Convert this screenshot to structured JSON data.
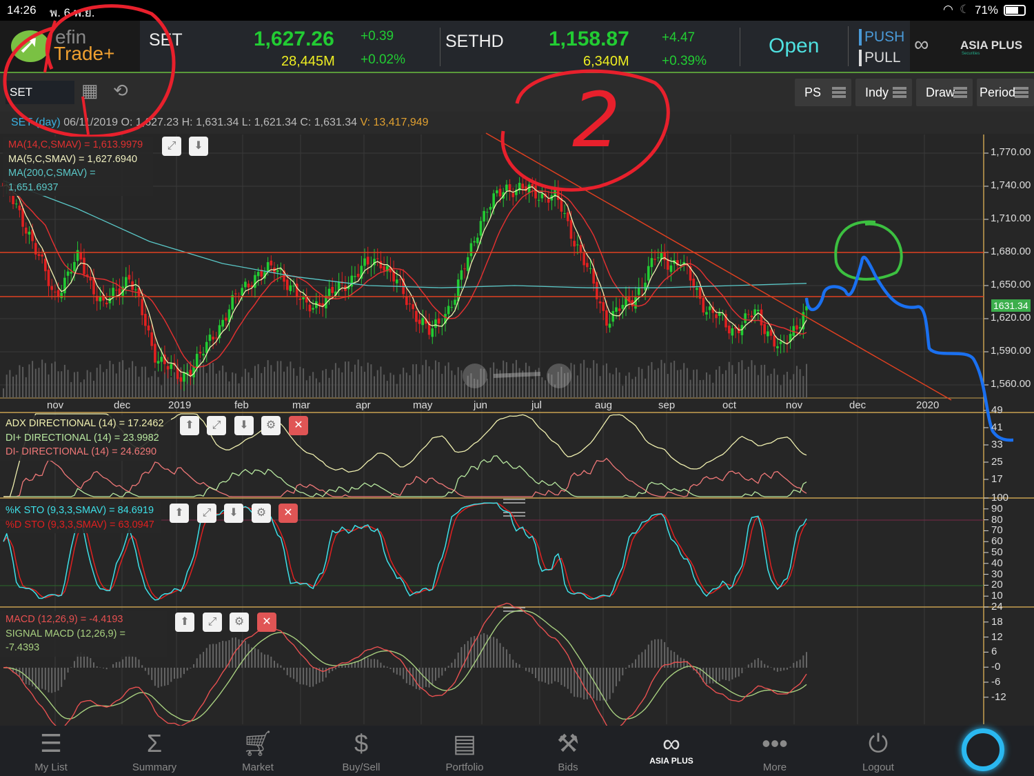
{
  "status_bar": {
    "time": "14:26",
    "date": "พ. 6 พ.ย.",
    "battery": "71%"
  },
  "header": {
    "logo_top": "efin",
    "logo_bottom": "Trade+",
    "index1": {
      "name": "SET",
      "value": "1,627.26",
      "change": "+0.39",
      "volume": "28,445M",
      "pct": "+0.02%"
    },
    "index2": {
      "name": "SETHD",
      "value": "1,158.87",
      "change": "+4.47",
      "volume": "6,340M",
      "pct": "+0.39%"
    },
    "market_status": "Open",
    "push": "PUSH",
    "pull": "PULL",
    "broker": "ASIA PLUS",
    "broker_sub": "Securities"
  },
  "toolbar": {
    "symbol": "SET",
    "buttons": [
      "PS",
      "Indy",
      "Draw",
      "Period"
    ]
  },
  "info": {
    "symbol": "SET (day)",
    "date": "06/11/2019",
    "o_label": "O:",
    "o": "1,627.23",
    "h_label": "H:",
    "h": "1,631.34",
    "l_label": "L:",
    "l": "1,621.34",
    "c_label": "C:",
    "c": "1,631.34",
    "v_label": "V:",
    "v": "13,417,949"
  },
  "main_legend": [
    "MA(14,C,SMAV) = 1,613.9979",
    "MA(5,C,SMAV) = 1,627.6940",
    "MA(200,C,SMAV) = 1,651.6937"
  ],
  "price_axis": [
    "1,770.00",
    "1,740.00",
    "1,710.00",
    "1,680.00",
    "1,650.00",
    "1,620.00",
    "1,590.00",
    "1,560.00"
  ],
  "last_price_tag": "1631.34",
  "months": [
    "nov",
    "dec",
    "2019",
    "feb",
    "mar",
    "apr",
    "may",
    "jun",
    "jul",
    "aug",
    "sep",
    "oct",
    "nov",
    "dec",
    "2020"
  ],
  "adx_legend": [
    "ADX DIRECTIONAL (14) = 17.2462",
    "DI+ DIRECTIONAL (14) = 23.9982",
    "DI- DIRECTIONAL (14) = 24.6290"
  ],
  "adx_axis": [
    "49",
    "41",
    "33",
    "25",
    "17"
  ],
  "sto_legend": [
    "%K STO (9,3,3,SMAV) = 84.6919",
    "%D STO (9,3,3,SMAV) = 63.0947"
  ],
  "sto_axis": [
    "100",
    "90",
    "80",
    "70",
    "60",
    "50",
    "40",
    "30",
    "20",
    "10"
  ],
  "macd_legend": [
    "MACD (12,26,9) = -4.4193",
    "SIGNAL MACD (12,26,9) = -7.4393"
  ],
  "macd_axis": [
    "24",
    "18",
    "12",
    "6",
    "-0",
    "-6",
    "-12"
  ],
  "annotation_text": "2",
  "nav": [
    "My List",
    "Summary",
    "Market",
    "Buy/Sell",
    "Portfolio",
    "Bids",
    "ASIA PLUS",
    "More",
    "Logout"
  ],
  "colors": {
    "up": "#22cc33",
    "down": "#e02020",
    "ma14": "#e03030",
    "ma5": "#f0f0b0",
    "ma200": "#5ac8c8",
    "accent": "#2ab8f0"
  },
  "chart_data": {
    "type": "candlestick",
    "x_range": [
      "2018-11",
      "2019-11-06"
    ],
    "close_keypoints": [
      1740,
      1700,
      1640,
      1675,
      1630,
      1660,
      1590,
      1565,
      1590,
      1630,
      1660,
      1665,
      1630,
      1640,
      1660,
      1675,
      1640,
      1605,
      1640,
      1710,
      1740,
      1735,
      1730,
      1680,
      1620,
      1635,
      1675,
      1670,
      1630,
      1610,
      1625,
      1590,
      1631.34
    ],
    "ma200_keypoints": [
      1745,
      1720,
      1690,
      1670,
      1658,
      1650,
      1648,
      1650,
      1648,
      1648,
      1650,
      1652
    ]
  }
}
